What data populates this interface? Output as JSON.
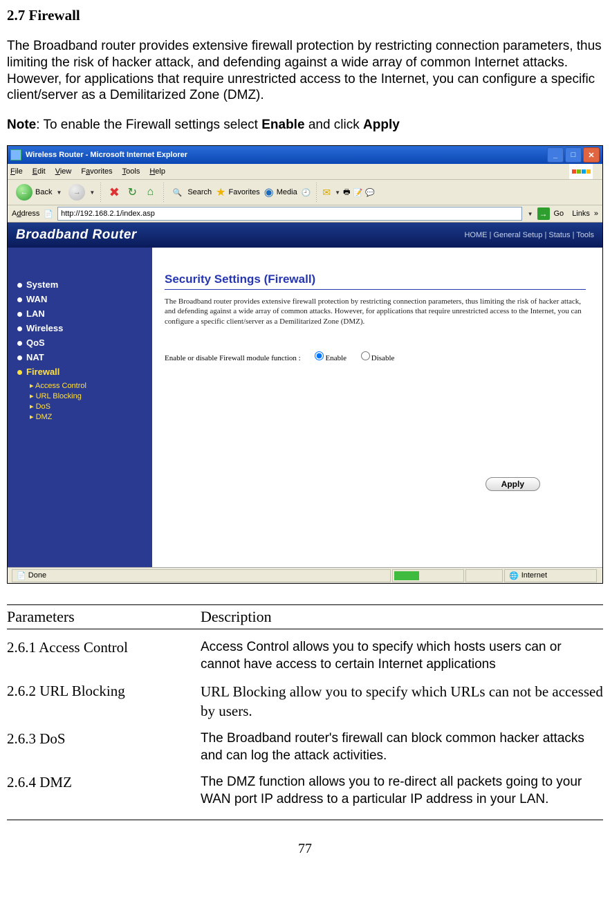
{
  "section_heading": "2.7 Firewall",
  "intro": "The Broadband router provides extensive firewall protection by restricting connection parameters, thus limiting the risk of hacker attack, and defending against a wide array of common Internet attacks. However, for applications that require unrestricted access to the Internet, you can configure a specific client/server as a Demilitarized Zone (DMZ).",
  "note_label": "Note",
  "note_text_pre": ": To enable the Firewall settings select ",
  "note_enable": "Enable",
  "note_mid": " and click ",
  "note_apply": "Apply",
  "ie": {
    "title": "Wireless Router - Microsoft Internet Explorer",
    "menu": {
      "file": "File",
      "edit": "Edit",
      "view": "View",
      "favorites": "Favorites",
      "tools": "Tools",
      "help": "Help"
    },
    "toolbar": {
      "back": "Back",
      "search": "Search",
      "favorites": "Favorites",
      "media": "Media"
    },
    "address_label": "Address",
    "address_value": "http://192.168.2.1/index.asp",
    "go": "Go",
    "links": "Links",
    "status_done": "Done",
    "status_zone": "Internet"
  },
  "router": {
    "brand": "Broadband Router",
    "navlinks": "HOME | General Setup | Status | Tools",
    "menu": {
      "system": "System",
      "wan": "WAN",
      "lan": "LAN",
      "wireless": "Wireless",
      "qos": "QoS",
      "nat": "NAT",
      "firewall": "Firewall",
      "sub": {
        "access": "Access Control",
        "url": "URL Blocking",
        "dos": "DoS",
        "dmz": "DMZ"
      }
    },
    "page_title": "Security Settings (Firewall)",
    "page_desc": "The Broadband router provides extensive firewall protection by restricting connection parameters, thus limiting the risk of hacker attack, and defending against a wide array of common attacks. However, for applications that require unrestricted access to the Internet, you can configure a specific client/server as a Demilitarized Zone (DMZ).",
    "option_label": "Enable or disable Firewall module function :",
    "enable": "Enable",
    "disable": "Disable",
    "apply": "Apply"
  },
  "params": {
    "h1": "Parameters",
    "h2": "Description",
    "rows": [
      {
        "name": "2.6.1 Access Control",
        "desc": "Access Control allows you to specify which hosts users can or cannot have access to certain Internet applications",
        "font": "sans"
      },
      {
        "name": "2.6.2 URL Blocking",
        "desc": "URL Blocking allow you to specify which URLs can not be accessed by users.",
        "font": "serif"
      },
      {
        "name": "2.6.3 DoS",
        "desc": "The Broadband router's firewall can block common hacker attacks and can log the attack activities.",
        "font": "sans"
      },
      {
        "name": "2.6.4 DMZ",
        "desc": "The DMZ function allows you to re-direct all packets going to your WAN port IP address to a particular IP address in your LAN.",
        "font": "sans"
      }
    ]
  },
  "page_number": "77"
}
